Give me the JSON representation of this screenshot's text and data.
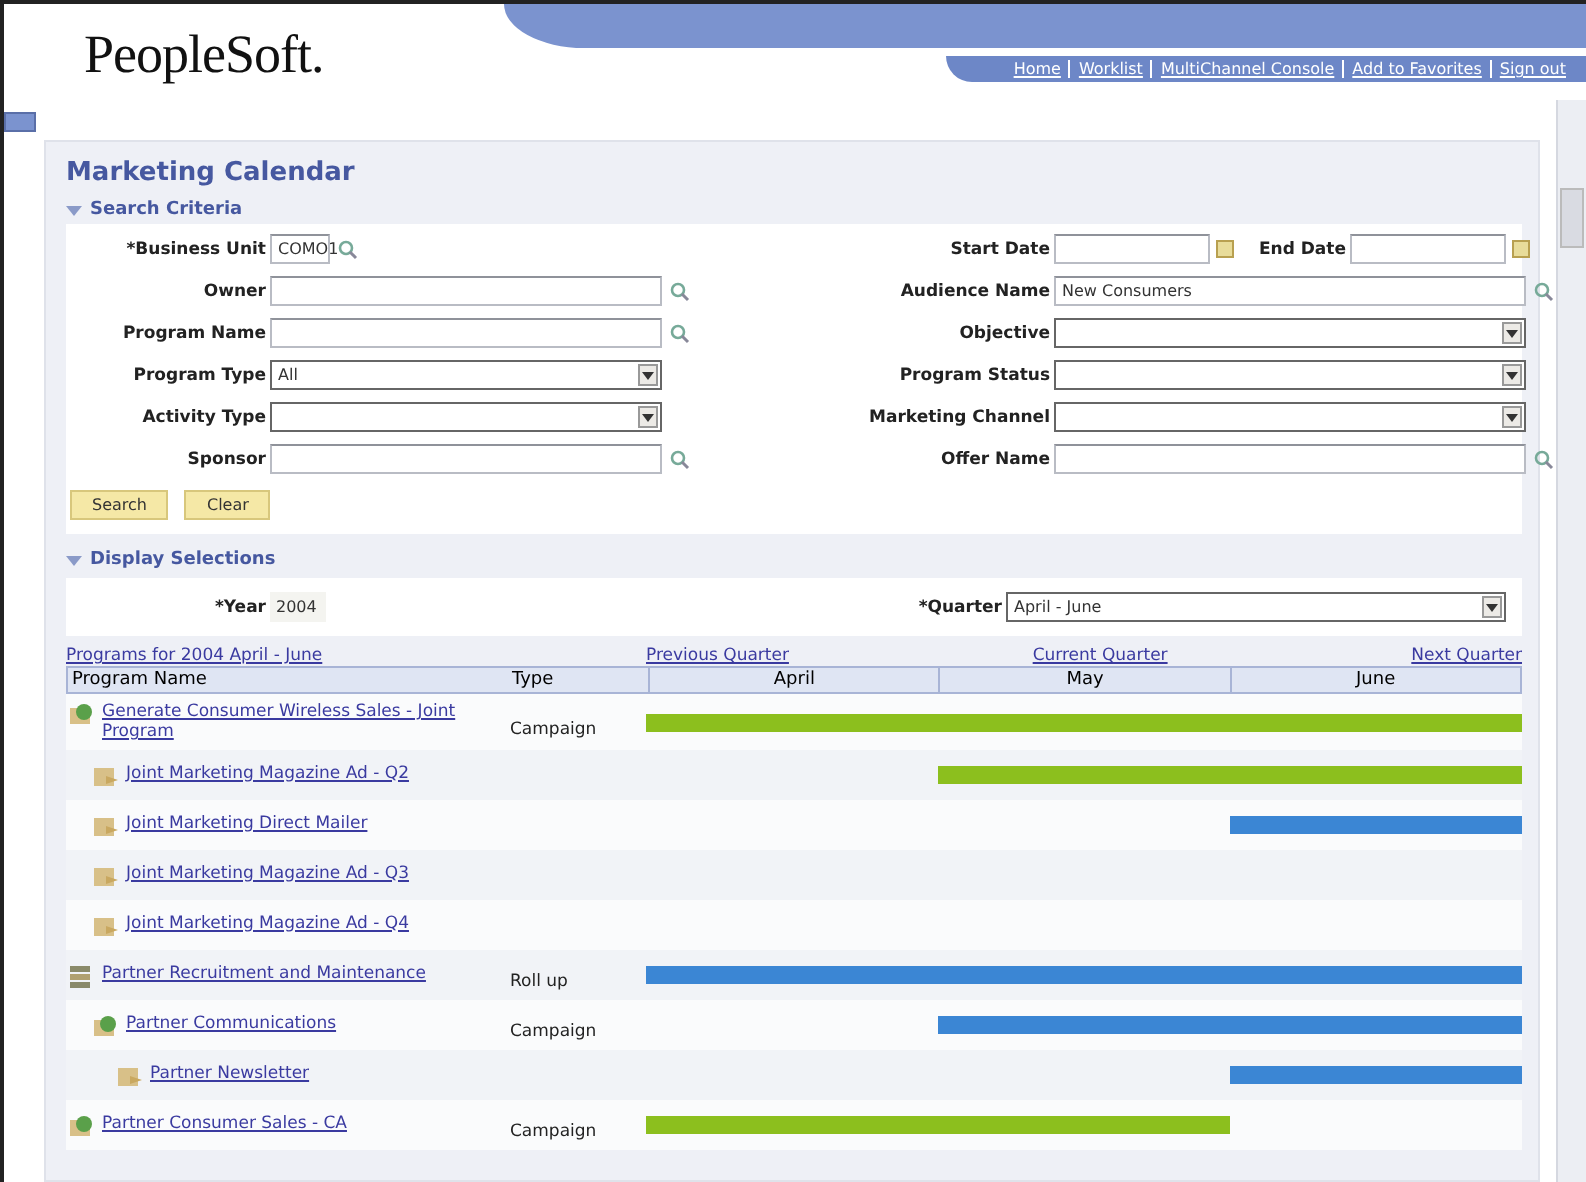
{
  "header": {
    "logo": "PeopleSoft.",
    "links": [
      "Home",
      "Worklist",
      "MultiChannel Console",
      "Add to Favorites",
      "Sign out"
    ]
  },
  "page_title": "Marketing Calendar",
  "search_criteria": {
    "title": "Search Criteria",
    "expanded": true,
    "rows": [
      {
        "left": {
          "label": "*Business Unit",
          "kind": "lookup_short",
          "value": "COMO1"
        },
        "right": [
          {
            "label": "Start Date",
            "kind": "date"
          },
          {
            "label": "End Date",
            "kind": "date"
          }
        ]
      },
      {
        "left": {
          "label": "Owner",
          "kind": "lookup"
        },
        "right": [
          {
            "label": "Audience Name",
            "kind": "lookup",
            "value": "New Consumers"
          }
        ]
      },
      {
        "left": {
          "label": "Program Name",
          "kind": "lookup"
        },
        "right": [
          {
            "label": "Objective",
            "kind": "select"
          }
        ]
      },
      {
        "left": {
          "label": "Program Type",
          "kind": "select",
          "value": "All"
        },
        "right": [
          {
            "label": "Program Status",
            "kind": "select"
          }
        ]
      },
      {
        "left": {
          "label": "Activity Type",
          "kind": "select"
        },
        "right": [
          {
            "label": "Marketing Channel",
            "kind": "select"
          }
        ]
      },
      {
        "left": {
          "label": "Sponsor",
          "kind": "lookup"
        },
        "right": [
          {
            "label": "Offer Name",
            "kind": "lookup"
          }
        ]
      }
    ],
    "buttons": [
      "Search",
      "Clear"
    ]
  },
  "display_selections": {
    "title": "Display Selections",
    "expanded": true,
    "year": {
      "label": "*Year",
      "value": "2004"
    },
    "quarter": {
      "label": "*Quarter",
      "value": "April - June"
    }
  },
  "calendar": {
    "caption": "Programs for 2004 April - June",
    "nav": [
      "Previous Quarter",
      "Current Quarter",
      "Next Quarter"
    ],
    "columns": [
      "Program Name",
      "Type"
    ],
    "months": [
      "April",
      "May",
      "June"
    ],
    "programs": [
      {
        "name": "Generate Consumer Wireless Sales - Joint Program",
        "kind": "campaign",
        "type": "Campaign",
        "bar": {
          "months": [
            true,
            true,
            true
          ],
          "color": "#8cbf1e"
        },
        "children": [
          {
            "name": "Joint Marketing Magazine Ad - Q2",
            "kind": "activity",
            "bar": {
              "months": [
                false,
                true,
                true
              ],
              "color": "#8cbf1e"
            }
          },
          {
            "name": "Joint Marketing Direct Mailer",
            "kind": "activity",
            "bar": {
              "months": [
                false,
                false,
                true
              ],
              "color": "#3b86d4"
            }
          },
          {
            "name": "Joint Marketing Magazine Ad - Q3",
            "kind": "activity"
          },
          {
            "name": "Joint Marketing Magazine Ad - Q4",
            "kind": "activity"
          }
        ]
      },
      {
        "name": "Partner Recruitment and Maintenance",
        "kind": "rollup",
        "type": "Roll up",
        "bar": {
          "months": [
            true,
            true,
            true
          ],
          "color": "#3b86d4"
        },
        "children": [
          {
            "name": "Partner Communications",
            "kind": "campaign",
            "type": "Campaign",
            "bar": {
              "months": [
                false,
                true,
                true
              ],
              "color": "#3b86d4"
            },
            "children": [
              {
                "name": "Partner Newsletter",
                "kind": "activity",
                "bar": {
                  "months": [
                    false,
                    false,
                    true
                  ],
                  "color": "#3b86d4"
                }
              }
            ]
          }
        ]
      },
      {
        "name": "Partner Consumer Sales - CA",
        "kind": "campaign",
        "type": "Campaign",
        "bar": {
          "months": [
            true,
            true,
            false
          ],
          "color": "#8cbf1e"
        }
      }
    ]
  }
}
